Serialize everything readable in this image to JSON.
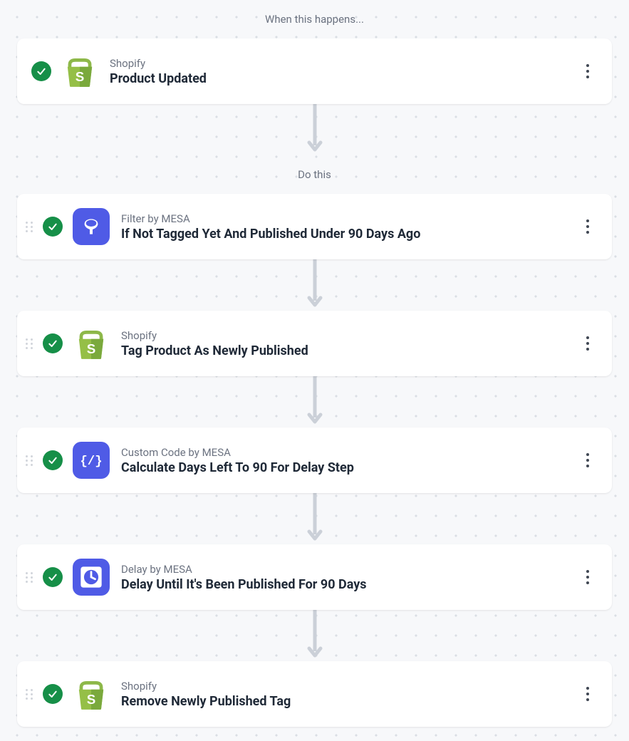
{
  "sections": {
    "trigger_label": "When this happens...",
    "action_label": "Do this"
  },
  "steps": [
    {
      "subtitle": "Shopify",
      "title": "Product Updated"
    },
    {
      "subtitle": "Filter by MESA",
      "title": "If Not Tagged Yet And Published Under 90 Days Ago"
    },
    {
      "subtitle": "Shopify",
      "title": "Tag Product As Newly Published"
    },
    {
      "subtitle": "Custom Code by MESA",
      "title": "Calculate Days Left To 90 For Delay Step"
    },
    {
      "subtitle": "Delay by MESA",
      "title": "Delay Until It's Been Published For 90 Days"
    },
    {
      "subtitle": "Shopify",
      "title": "Remove Newly Published Tag"
    }
  ]
}
